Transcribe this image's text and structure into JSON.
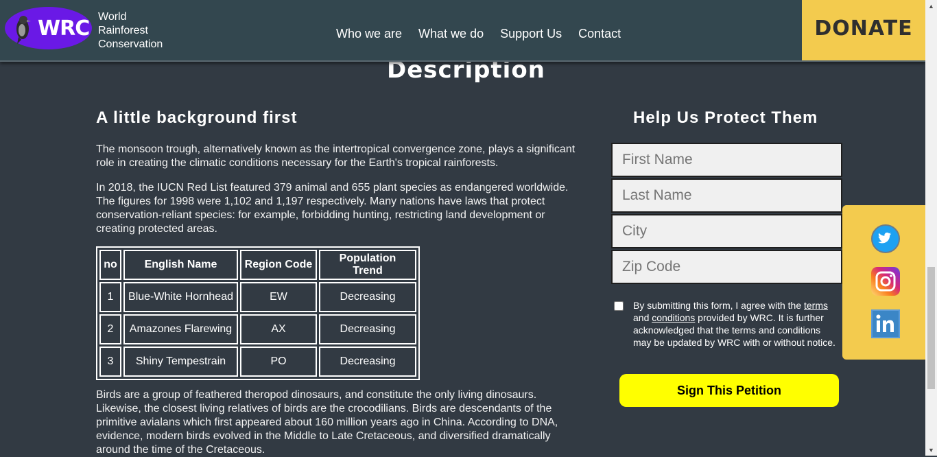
{
  "header": {
    "logo_text": "WRC",
    "org_name": [
      "World",
      "Rainforest",
      "Conservation"
    ],
    "nav": [
      "Who we are",
      "What we do",
      "Support Us",
      "Contact"
    ],
    "donate_label": "DONATE"
  },
  "main": {
    "section_title": "Description",
    "background_title": "A little background first",
    "paragraph_1": "The monsoon trough, alternatively known as the intertropical convergence zone, plays a significant role in creating the climatic conditions necessary for the Earth's tropical rainforests.",
    "paragraph_2": "In 2018, the IUCN Red List featured 379 animal and 655 plant species as endangered worldwide. The figures for 1998 were 1,102 and 1,197 respectively. Many nations have laws that protect conservation-reliant species: for example, forbidding hunting, restricting land development or creating protected areas.",
    "paragraph_3": "Birds are a group of feathered theropod dinosaurs, and constitute the only living dinosaurs. Likewise, the closest living relatives of birds are the crocodilians. Birds are descendants of the primitive avialans which first appeared about 160 million years ago in China. According to DNA, evidence, modern birds evolved in the Middle to Late Cretaceous, and diversified dramatically around the time of the Cretaceous.",
    "table": {
      "headers": [
        "no",
        "English Name",
        "Region Code",
        "Population Trend"
      ],
      "rows": [
        [
          "1",
          "Blue-White Hornhead",
          "EW",
          "Decreasing"
        ],
        [
          "2",
          "Amazones Flarewing",
          "AX",
          "Decreasing"
        ],
        [
          "3",
          "Shiny Tempestrain",
          "PO",
          "Decreasing"
        ]
      ]
    }
  },
  "form": {
    "title": "Help Us Protect Them",
    "first_name_placeholder": "First Name",
    "last_name_placeholder": "Last Name",
    "city_placeholder": "City",
    "zip_placeholder": "Zip Code",
    "consent_pre": "By submitting this form, I agree with the ",
    "consent_terms": "terms",
    "consent_and": " and ",
    "consent_conditions": "conditions",
    "consent_post": " provided by WRC. It is further acknowledged that the terms and conditions may be updated by WRC with or without notice.",
    "submit_label": "Sign This Petition"
  },
  "social": [
    "twitter-icon",
    "instagram-icon",
    "linkedin-icon"
  ],
  "colors": {
    "header_bg": "#33474f",
    "page_bg": "#323a43",
    "donate_bg": "#f3cb4e",
    "logo_bg": "#6a19e6",
    "button_bg": "#ffff00"
  }
}
